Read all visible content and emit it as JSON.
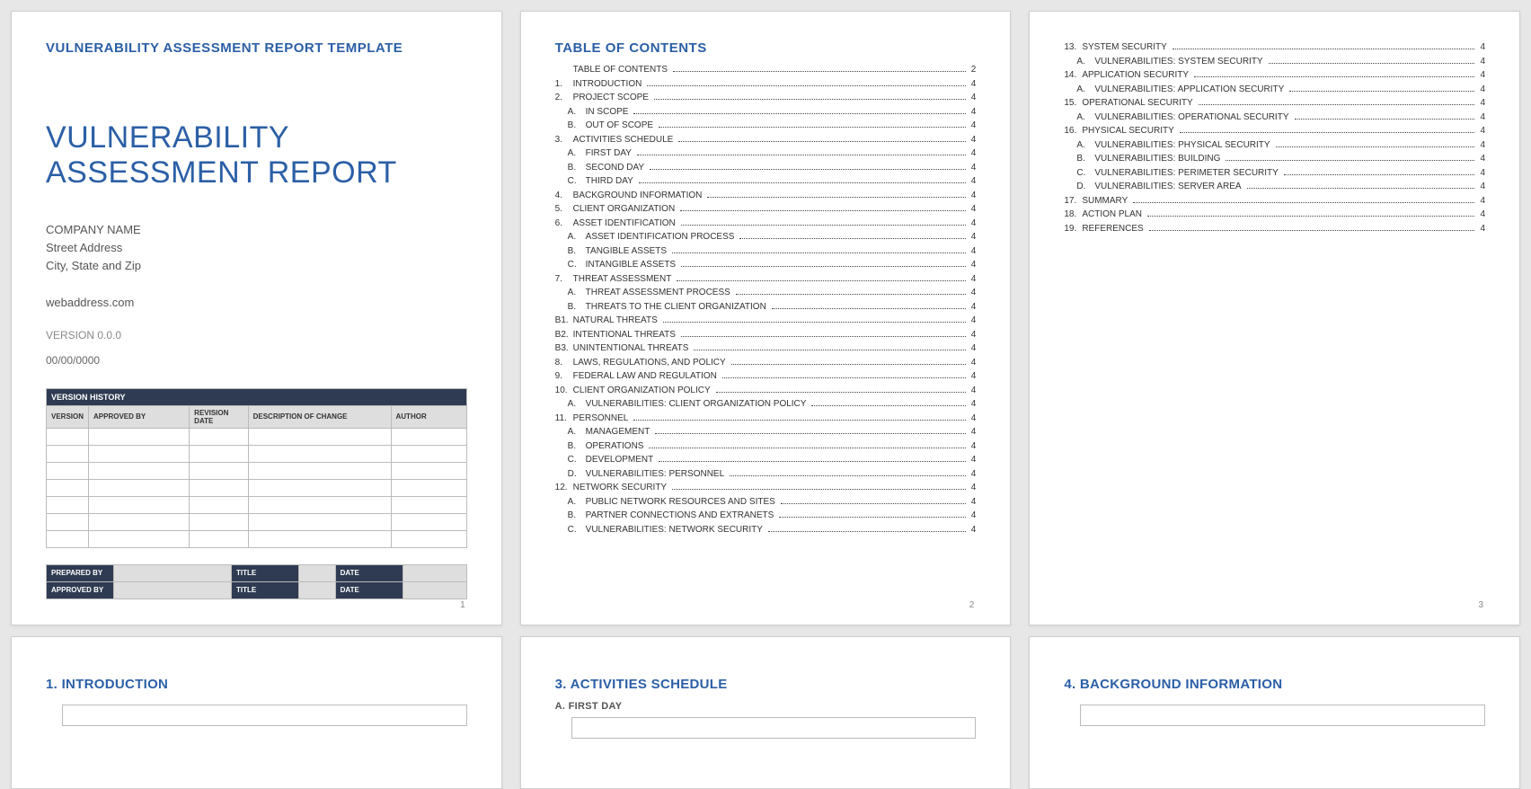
{
  "cover": {
    "header": "VULNERABILITY ASSESSMENT REPORT TEMPLATE",
    "title_line1": "VULNERABILITY",
    "title_line2": "ASSESSMENT REPORT",
    "company": "COMPANY NAME",
    "addr1": "Street Address",
    "addr2": "City, State and Zip",
    "web": "webaddress.com",
    "version": "VERSION 0.0.0",
    "date": "00/00/0000",
    "vh_title": "VERSION HISTORY",
    "cols": {
      "c1": "VERSION",
      "c2": "APPROVED BY",
      "c3": "REVISION DATE",
      "c4": "DESCRIPTION OF CHANGE",
      "c5": "AUTHOR"
    },
    "sign": {
      "prepared": "PREPARED BY",
      "approved": "APPROVED BY",
      "title": "TITLE",
      "date": "DATE"
    },
    "pnum": "1"
  },
  "toc": {
    "title": "TABLE OF CONTENTS",
    "p2_items": [
      {
        "n": "",
        "t": "TABLE OF CONTENTS",
        "p": "2",
        "sub": false,
        "noind": true
      },
      {
        "n": "1.",
        "t": "INTRODUCTION",
        "p": "4",
        "sub": false
      },
      {
        "n": "2.",
        "t": "PROJECT SCOPE",
        "p": "4",
        "sub": false
      },
      {
        "n": "A.",
        "t": "IN SCOPE",
        "p": "4",
        "sub": true
      },
      {
        "n": "B.",
        "t": "OUT OF SCOPE",
        "p": "4",
        "sub": true
      },
      {
        "n": "3.",
        "t": "ACTIVITIES SCHEDULE",
        "p": "4",
        "sub": false
      },
      {
        "n": "A.",
        "t": "FIRST DAY",
        "p": "4",
        "sub": true
      },
      {
        "n": "B.",
        "t": "SECOND DAY",
        "p": "4",
        "sub": true
      },
      {
        "n": "C.",
        "t": "THIRD DAY",
        "p": "4",
        "sub": true
      },
      {
        "n": "4.",
        "t": "BACKGROUND INFORMATION",
        "p": "4",
        "sub": false
      },
      {
        "n": "5.",
        "t": "CLIENT ORGANIZATION",
        "p": "4",
        "sub": false
      },
      {
        "n": "6.",
        "t": "ASSET IDENTIFICATION",
        "p": "4",
        "sub": false
      },
      {
        "n": "A.",
        "t": "ASSET IDENTIFICATION PROCESS",
        "p": "4",
        "sub": true
      },
      {
        "n": "B.",
        "t": "TANGIBLE ASSETS",
        "p": "4",
        "sub": true
      },
      {
        "n": "C.",
        "t": "INTANGIBLE ASSETS",
        "p": "4",
        "sub": true
      },
      {
        "n": "7.",
        "t": "THREAT ASSESSMENT",
        "p": "4",
        "sub": false
      },
      {
        "n": "A.",
        "t": "THREAT ASSESSMENT PROCESS",
        "p": "4",
        "sub": true
      },
      {
        "n": "B.",
        "t": "THREATS TO THE CLIENT ORGANIZATION",
        "p": "4",
        "sub": true
      },
      {
        "n": "B1.",
        "t": "NATURAL THREATS",
        "p": "4",
        "sub": false,
        "noind": true
      },
      {
        "n": "B2.",
        "t": "INTENTIONAL THREATS",
        "p": "4",
        "sub": false,
        "noind": true
      },
      {
        "n": "B3.",
        "t": "UNINTENTIONAL THREATS",
        "p": "4",
        "sub": false,
        "noind": true
      },
      {
        "n": "8.",
        "t": "LAWS, REGULATIONS, AND POLICY",
        "p": "4",
        "sub": false
      },
      {
        "n": "9.",
        "t": "FEDERAL LAW AND REGULATION",
        "p": "4",
        "sub": false
      },
      {
        "n": "10.",
        "t": "CLIENT ORGANIZATION POLICY",
        "p": "4",
        "sub": false
      },
      {
        "n": "A.",
        "t": "VULNERABILITIES: CLIENT ORGANIZATION POLICY",
        "p": "4",
        "sub": true
      },
      {
        "n": "11.",
        "t": "PERSONNEL",
        "p": "4",
        "sub": false
      },
      {
        "n": "A.",
        "t": "MANAGEMENT",
        "p": "4",
        "sub": true
      },
      {
        "n": "B.",
        "t": "OPERATIONS",
        "p": "4",
        "sub": true
      },
      {
        "n": "C.",
        "t": "DEVELOPMENT",
        "p": "4",
        "sub": true
      },
      {
        "n": "D.",
        "t": "VULNERABILITIES: PERSONNEL",
        "p": "4",
        "sub": true
      },
      {
        "n": "12.",
        "t": "NETWORK SECURITY",
        "p": "4",
        "sub": false
      },
      {
        "n": "A.",
        "t": "PUBLIC NETWORK RESOURCES AND SITES",
        "p": "4",
        "sub": true
      },
      {
        "n": "B.",
        "t": "PARTNER CONNECTIONS AND EXTRANETS",
        "p": "4",
        "sub": true
      },
      {
        "n": "C.",
        "t": "VULNERABILITIES: NETWORK SECURITY",
        "p": "4",
        "sub": true
      }
    ],
    "p2_num": "2",
    "p3_items": [
      {
        "n": "13.",
        "t": "SYSTEM SECURITY",
        "p": "4",
        "sub": false
      },
      {
        "n": "A.",
        "t": "VULNERABILITIES: SYSTEM SECURITY",
        "p": "4",
        "sub": true
      },
      {
        "n": "14.",
        "t": "APPLICATION SECURITY",
        "p": "4",
        "sub": false
      },
      {
        "n": "A.",
        "t": "VULNERABILITIES: APPLICATION SECURITY",
        "p": "4",
        "sub": true
      },
      {
        "n": "15.",
        "t": "OPERATIONAL SECURITY",
        "p": "4",
        "sub": false
      },
      {
        "n": "A.",
        "t": "VULNERABILITIES: OPERATIONAL SECURITY",
        "p": "4",
        "sub": true
      },
      {
        "n": "16.",
        "t": "PHYSICAL SECURITY",
        "p": "4",
        "sub": false
      },
      {
        "n": "A.",
        "t": "VULNERABILITIES: PHYSICAL SECURITY",
        "p": "4",
        "sub": true
      },
      {
        "n": "B.",
        "t": "VULNERABILITIES: BUILDING",
        "p": "4",
        "sub": true
      },
      {
        "n": "C.",
        "t": "VULNERABILITIES: PERIMETER SECURITY",
        "p": "4",
        "sub": true
      },
      {
        "n": "D.",
        "t": "VULNERABILITIES: SERVER AREA",
        "p": "4",
        "sub": true
      },
      {
        "n": "17.",
        "t": "SUMMARY",
        "p": "4",
        "sub": false
      },
      {
        "n": "18.",
        "t": "ACTION PLAN",
        "p": "4",
        "sub": false
      },
      {
        "n": "19.",
        "t": "REFERENCES",
        "p": "4",
        "sub": false
      }
    ],
    "p3_num": "3"
  },
  "sections": {
    "s1": "1.  INTRODUCTION",
    "s3": "3.  ACTIVITIES SCHEDULE",
    "s3a": "A.  FIRST DAY",
    "s4": "4.  BACKGROUND INFORMATION"
  }
}
